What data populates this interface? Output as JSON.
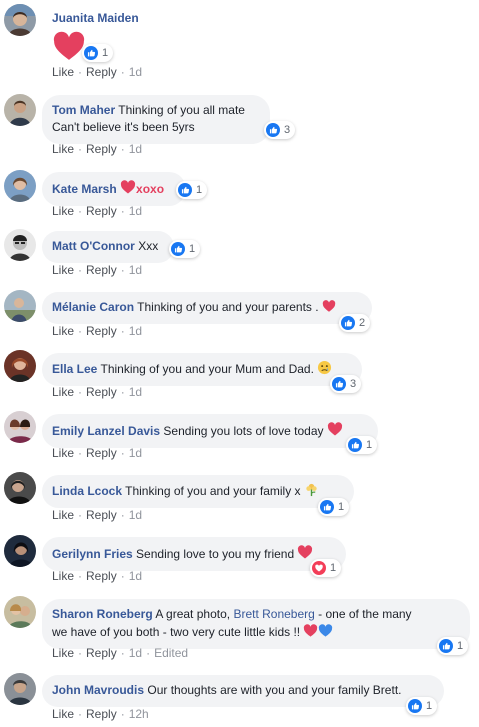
{
  "colors": {
    "link": "#385898",
    "like": "#1877f2",
    "love": "#f33e58",
    "heart": "#e4405f"
  },
  "actions": {
    "like": "Like",
    "reply": "Reply",
    "edited": "Edited"
  },
  "comments": [
    {
      "author": "Juanita Maiden",
      "text": "",
      "reaction_count": "1",
      "time": "1d",
      "reaction": "like-icon"
    },
    {
      "author": "Tom Maher",
      "text": "Thinking of you all mate",
      "text2": "Can't believe it's been 5yrs",
      "reaction_count": "3",
      "time": "1d",
      "reaction": "like-icon"
    },
    {
      "author": "Kate Marsh",
      "text": "xoxo",
      "reaction_count": "1",
      "time": "1d",
      "reaction": "like-icon"
    },
    {
      "author": "Matt O'Connor",
      "text": "Xxx",
      "reaction_count": "1",
      "time": "1d",
      "reaction": "like-icon"
    },
    {
      "author": "Mélanie Caron",
      "text": "Thinking of you and your parents .",
      "reaction_count": "2",
      "time": "1d",
      "reaction": "like-icon"
    },
    {
      "author": "Ella Lee",
      "text": "Thinking of you and your Mum and Dad.",
      "reaction_count": "3",
      "time": "1d",
      "reaction": "like-icon"
    },
    {
      "author": "Emily Lanzel Davis",
      "text": "Sending you lots of love today",
      "reaction_count": "1",
      "time": "1d",
      "reaction": "like-icon"
    },
    {
      "author": "Linda Lcock",
      "text": "Thinking of you and your family x",
      "reaction_count": "1",
      "time": "1d",
      "reaction": "like-icon"
    },
    {
      "author": "Gerilynn Fries",
      "text": "Sending love to you my friend",
      "reaction_count": "1",
      "time": "1d",
      "reaction": "love-icon"
    },
    {
      "author": "Sharon Roneberg",
      "text": "A great photo,",
      "mention": "Brett Roneberg",
      "text_after": "- one of the many",
      "text2": "we have of you both - two very cute little kids !!",
      "reaction_count": "1",
      "time": "1d",
      "reaction": "like-icon"
    },
    {
      "author": "John Mavroudis",
      "text": "Our thoughts are with you and your family Brett.",
      "reaction_count": "1",
      "time": "12h",
      "reaction": "like-icon"
    }
  ]
}
